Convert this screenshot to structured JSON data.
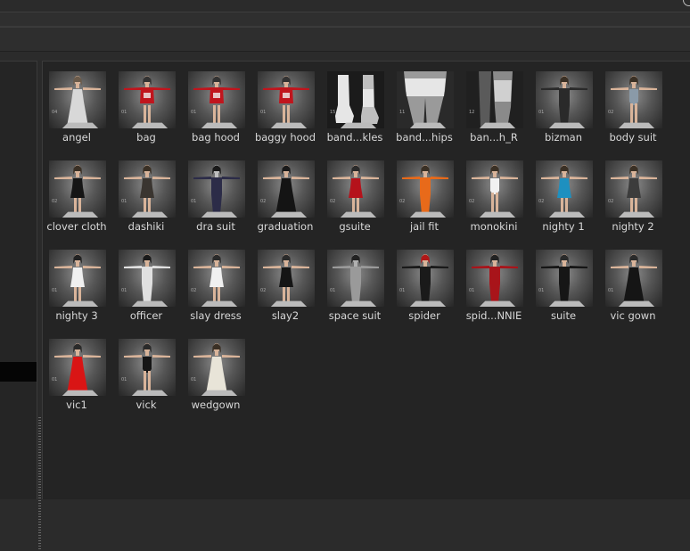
{
  "items": [
    {
      "label": "angel",
      "badge": "04",
      "pose": "t",
      "outfit": "gown",
      "color": "#d8d8d8",
      "hair": "#6b5b4b",
      "skin": "#d9b49a"
    },
    {
      "label": "bag",
      "badge": "01",
      "pose": "t",
      "outfit": "hoodie",
      "color": "#c0151d",
      "hair": "#333333",
      "skin": "#d9b49a"
    },
    {
      "label": "bag hood",
      "badge": "01",
      "pose": "t",
      "outfit": "hoodie",
      "color": "#c0151d",
      "hair": "#333333",
      "skin": "#d9b49a"
    },
    {
      "label": "baggy hood",
      "badge": "01",
      "pose": "t",
      "outfit": "hoodie",
      "color": "#c0151d",
      "hair": "#333333",
      "skin": "#d9b49a"
    },
    {
      "label": "band...kles",
      "badge": "15",
      "pose": "feet",
      "outfit": "bandage",
      "color": "#e6e6e6",
      "hair": "#333333",
      "skin": "#bfbfbf"
    },
    {
      "label": "band...hips",
      "badge": "11",
      "pose": "legs",
      "outfit": "bandage",
      "color": "#e6e6e6",
      "hair": "#333333",
      "skin": "#9a9a9a"
    },
    {
      "label": "ban...h_R",
      "badge": "12",
      "pose": "leg",
      "outfit": "bandage",
      "color": "#d0d0d0",
      "hair": "#333333",
      "skin": "#8a8a8a"
    },
    {
      "label": "bizman",
      "badge": "01",
      "pose": "t",
      "outfit": "suit",
      "color": "#2a2a2a",
      "hair": "#3a3025",
      "skin": "#d9b49a"
    },
    {
      "label": "body suit",
      "badge": "02",
      "pose": "t",
      "outfit": "leotard",
      "color": "#8a9aa8",
      "hair": "#3a3025",
      "skin": "#d9b49a"
    },
    {
      "label": "clover cloth",
      "badge": "02",
      "pose": "t",
      "outfit": "dress",
      "color": "#151515",
      "hair": "#3a3025",
      "skin": "#d9b49a"
    },
    {
      "label": "dashiki",
      "badge": "01",
      "pose": "t",
      "outfit": "dress",
      "color": "#3a3530",
      "hair": "#3a3025",
      "skin": "#d9b49a"
    },
    {
      "label": "dra suit",
      "badge": "01",
      "pose": "t",
      "outfit": "bodysuit",
      "color": "#2c2c48",
      "hair": "#1a1a1a",
      "skin": "#c0c0c0"
    },
    {
      "label": "graduation",
      "badge": "02",
      "pose": "t",
      "outfit": "gown",
      "color": "#141414",
      "hair": "#1a1a1a",
      "skin": "#d9b49a"
    },
    {
      "label": "gsuite",
      "badge": "02",
      "pose": "t",
      "outfit": "dress",
      "color": "#b5121b",
      "hair": "#2a2a2a",
      "skin": "#d9b49a"
    },
    {
      "label": "jail fit",
      "badge": "02",
      "pose": "t",
      "outfit": "jumpsuit",
      "color": "#e86a1a",
      "hair": "#3a3025",
      "skin": "#d9b49a"
    },
    {
      "label": "monokini",
      "badge": "02",
      "pose": "t",
      "outfit": "swimsuit",
      "color": "#f2f2f2",
      "hair": "#3a3025",
      "skin": "#d9b49a"
    },
    {
      "label": "nighty 1",
      "badge": "02",
      "pose": "t",
      "outfit": "dress",
      "color": "#1e90c0",
      "hair": "#3a3025",
      "skin": "#d9b49a"
    },
    {
      "label": "nighty 2",
      "badge": "02",
      "pose": "t",
      "outfit": "dress",
      "color": "#3c3c3c",
      "hair": "#3a3025",
      "skin": "#d9b49a"
    },
    {
      "label": "nighty 3",
      "badge": "01",
      "pose": "t",
      "outfit": "dress",
      "color": "#f0f0f0",
      "hair": "#222222",
      "skin": "#d9b49a"
    },
    {
      "label": "officer",
      "badge": "01",
      "pose": "t",
      "outfit": "suit",
      "color": "#e0e0e0",
      "hair": "#1a1a1a",
      "skin": "#d9b49a"
    },
    {
      "label": "slay dress",
      "badge": "02",
      "pose": "t",
      "outfit": "dress",
      "color": "#f0f0f0",
      "hair": "#2a2a2a",
      "skin": "#d9b49a"
    },
    {
      "label": "slay2",
      "badge": "02",
      "pose": "t",
      "outfit": "dress",
      "color": "#151515",
      "hair": "#2a2a2a",
      "skin": "#d9b49a"
    },
    {
      "label": "space suit",
      "badge": "01",
      "pose": "t",
      "outfit": "jumpsuit",
      "color": "#9a9a9a",
      "hair": "#222222",
      "skin": "#b0b0b0"
    },
    {
      "label": "spider",
      "badge": "01",
      "pose": "t",
      "outfit": "bodysuit",
      "color": "#1a1a1a",
      "hair": "#b01818",
      "skin": "#d9b49a"
    },
    {
      "label": "spid...NNIE",
      "badge": "01",
      "pose": "t",
      "outfit": "bodysuit",
      "color": "#a8141a",
      "hair": "#222222",
      "skin": "#d9b49a"
    },
    {
      "label": "suite",
      "badge": "01",
      "pose": "t",
      "outfit": "suit",
      "color": "#161616",
      "hair": "#2a2a2a",
      "skin": "#d9b49a"
    },
    {
      "label": "vic gown",
      "badge": "01",
      "pose": "t",
      "outfit": "gown",
      "color": "#151515",
      "hair": "#2a2a2a",
      "skin": "#d9b49a"
    },
    {
      "label": "vic1",
      "badge": "01",
      "pose": "t",
      "outfit": "gown",
      "color": "#d91515",
      "hair": "#2a2a2a",
      "skin": "#d9b49a"
    },
    {
      "label": "vick",
      "badge": "01",
      "pose": "t",
      "outfit": "swimsuit",
      "color": "#151515",
      "hair": "#2a2a2a",
      "skin": "#d9b49a"
    },
    {
      "label": "wedgown",
      "badge": "01",
      "pose": "t",
      "outfit": "gown",
      "color": "#e8e4d8",
      "hair": "#3a3025",
      "skin": "#d9b49a"
    }
  ]
}
